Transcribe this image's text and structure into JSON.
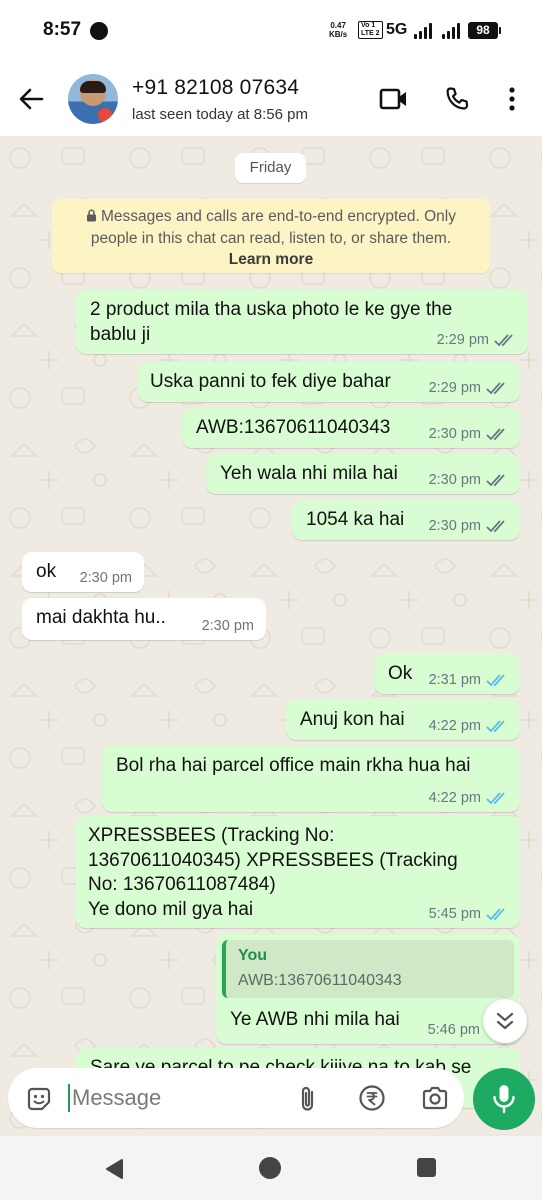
{
  "status_bar": {
    "time": "8:57",
    "speed_value": "0.47",
    "speed_unit": "KB/s",
    "volte_line1": "Vo 1",
    "volte_line2": "LTE 2",
    "network": "5G",
    "battery": "98"
  },
  "header": {
    "contact_name": "+91 82108 07634",
    "last_seen": "last seen today at 8:56 pm"
  },
  "chat": {
    "date_chip": "Friday",
    "encryption_notice": "Messages and calls are end-to-end encrypted. Only people in this chat can read, listen to, or share them.",
    "encryption_line1": "Messages and calls are end-to-end encrypted. Only",
    "encryption_line2": "people in this chat can read, listen to, or share them.",
    "learn_more": "Learn more",
    "messages": [
      {
        "dir": "out",
        "line1": "2 product mila tha uska photo le ke gye the",
        "line2": "bablu ji",
        "time": "2:29 pm",
        "read": false
      },
      {
        "dir": "out",
        "text": "Uska panni to fek diye bahar",
        "time": "2:29 pm",
        "read": false
      },
      {
        "dir": "out",
        "text": "AWB:13670611040343",
        "time": "2:30 pm",
        "read": false
      },
      {
        "dir": "out",
        "text": "Yeh wala nhi mila hai",
        "time": "2:30 pm",
        "read": false
      },
      {
        "dir": "out",
        "text": "1054 ka hai",
        "time": "2:30 pm",
        "read": false
      },
      {
        "dir": "in",
        "text": "ok",
        "time": "2:30 pm"
      },
      {
        "dir": "in",
        "text": "mai dakhta hu..",
        "time": "2:30 pm"
      },
      {
        "dir": "out",
        "text": "Ok",
        "time": "2:31 pm",
        "read": true
      },
      {
        "dir": "out",
        "text": "Anuj kon hai",
        "time": "4:22 pm",
        "read": true
      },
      {
        "dir": "out",
        "text": "Bol rha hai parcel office main rkha hua hai",
        "time": "4:22 pm",
        "read": true
      },
      {
        "dir": "out",
        "line1": "XPRESSBEES (Tracking No:",
        "line2": "13670611040345) XPRESSBEES (Tracking",
        "line3": "No: 13670611087484)",
        "line4": "Ye dono mil gya hai",
        "time": "5:45 pm",
        "read": true
      },
      {
        "dir": "out",
        "quote_name": "You",
        "quote_text": "AWB:13670611040343",
        "text": "Ye AWB nhi mila hai",
        "time": "5:46 pm"
      },
      {
        "dir": "out",
        "text": "Sare ye parcel to pe check kijiye na to kab se",
        "partial": true
      }
    ]
  },
  "composer": {
    "placeholder": "Message"
  },
  "colors": {
    "accent_green": "#1daa61",
    "outgoing_bubble": "#d9fdd3",
    "incoming_bubble": "#ffffff",
    "read_tick_blue": "#53bdeb",
    "chat_background": "#efeae2"
  }
}
